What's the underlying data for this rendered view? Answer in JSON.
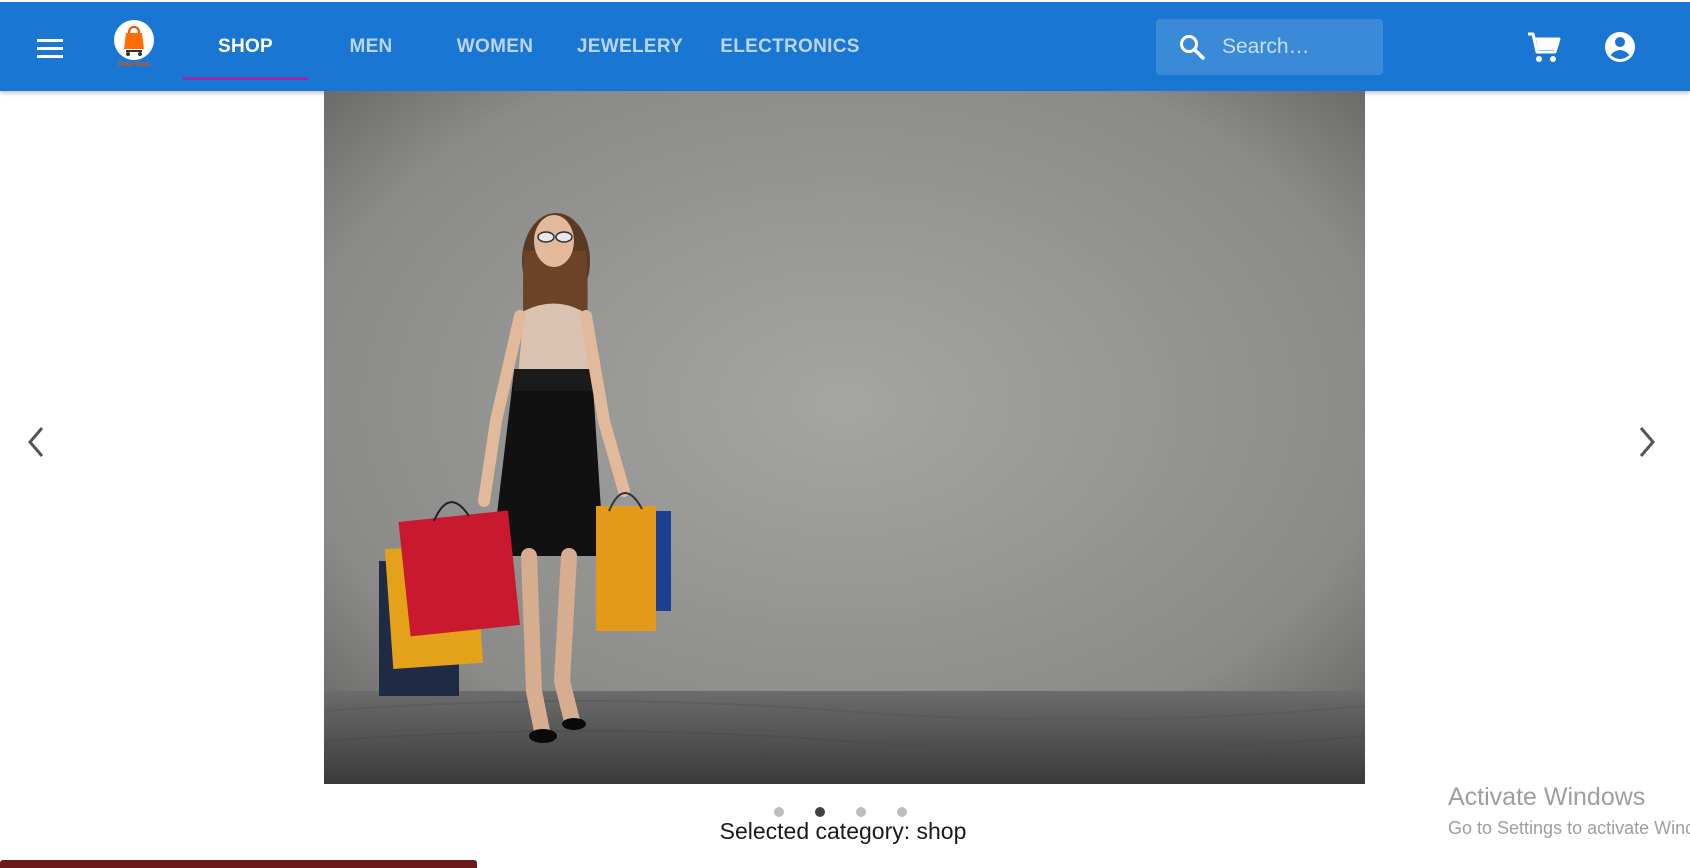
{
  "logo": {
    "caption": "Shop Stock"
  },
  "nav": {
    "tabs": [
      {
        "label": "SHOP",
        "active": true
      },
      {
        "label": "MEN",
        "active": false
      },
      {
        "label": "WOMEN",
        "active": false
      },
      {
        "label": "JEWELERY",
        "active": false
      },
      {
        "label": "ELECTRONICS",
        "active": false
      }
    ]
  },
  "search": {
    "placeholder": "Search…",
    "value": ""
  },
  "icons": {
    "menu": "menu-icon",
    "search": "search-icon",
    "cart": "cart-icon",
    "account": "account-circle-icon",
    "prev": "chevron-left-icon",
    "next": "chevron-right-icon"
  },
  "carousel": {
    "slide_count": 4,
    "active_index": 1
  },
  "selected_category": "Selected category: shop",
  "watermark": {
    "title": "Activate Windows",
    "subtitle": "Go to Settings to activate Windows."
  },
  "colors": {
    "appbar": "#1976d2",
    "tab_indicator": "#9c27b0",
    "dot_active": "#424242",
    "dot_inactive": "#bdbdbd"
  }
}
